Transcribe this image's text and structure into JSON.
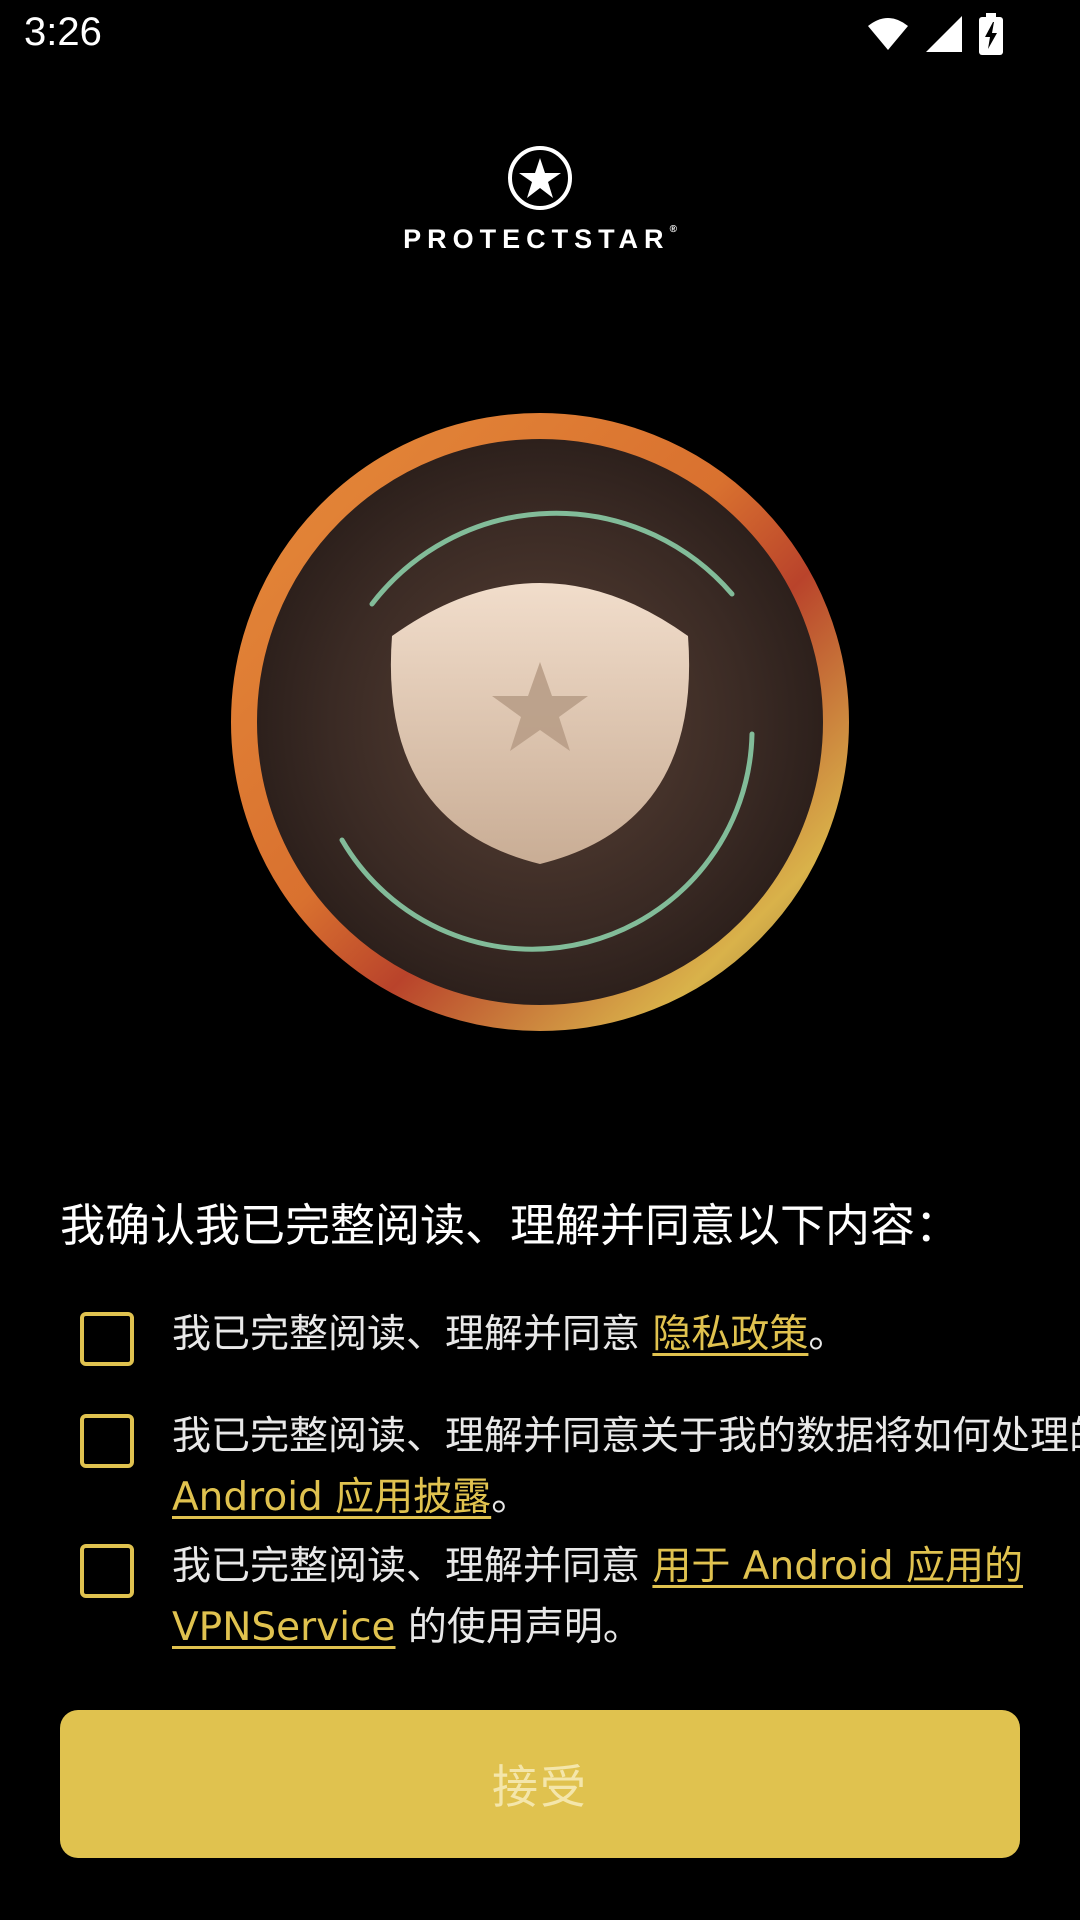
{
  "status_bar": {
    "time": "3:26",
    "icons": [
      "wifi-icon",
      "cellular-signal-icon",
      "battery-charging-icon"
    ]
  },
  "brand": {
    "name": "PROTECTSTAR",
    "trademark": "®",
    "icon": "star-circle-logo-icon"
  },
  "hero": {
    "icon": "shield-star-emblem"
  },
  "headline": "我确认我已完整阅读、理解并同意以下内容：",
  "consents": [
    {
      "prefix": "我已完整阅读、理解并同意 ",
      "link": "隐私政策",
      "suffix": "。",
      "checked": false
    },
    {
      "prefix": "我已完整阅读、理解并同意关于我的数据将如何处理的 ",
      "link": "Android 应用披露",
      "suffix": "。",
      "checked": false
    },
    {
      "prefix": "我已完整阅读、理解并同意 ",
      "link": "用于 Android 应用的 VPNService",
      "suffix": " 的使用声明。",
      "checked": false
    }
  ],
  "accept_button": {
    "label": "接受",
    "enabled": false
  },
  "colors": {
    "background": "#000000",
    "accent": "#e0c24f",
    "text": "#ffffff",
    "disabled_label": "#f4e6ab"
  }
}
